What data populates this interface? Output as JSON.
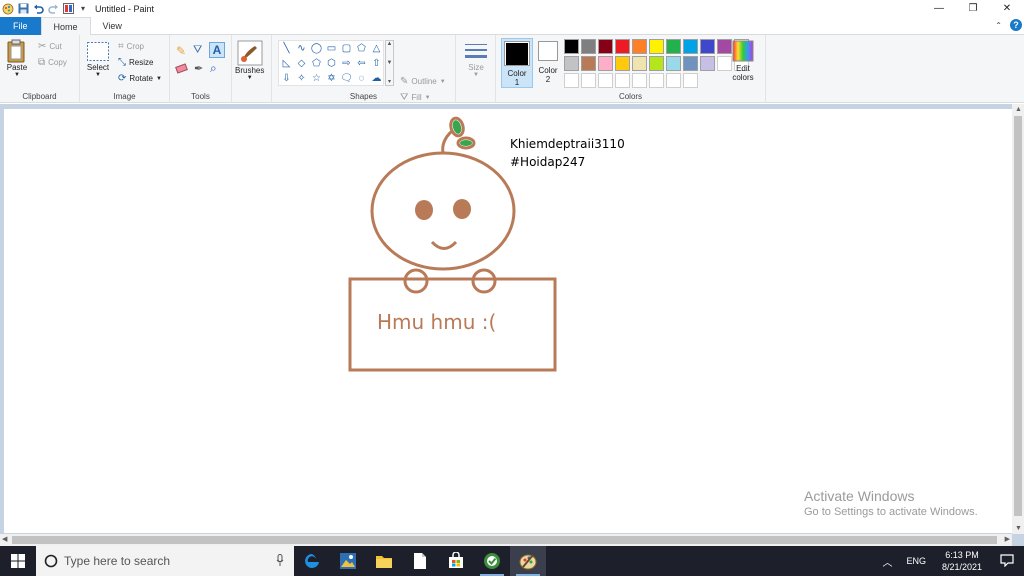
{
  "window": {
    "title": "Untitled - Paint",
    "controls": {
      "minimize": "—",
      "restore": "❐",
      "close": "✕"
    }
  },
  "tabs": {
    "file": "File",
    "home": "Home",
    "view": "View"
  },
  "ribbon": {
    "clipboard": {
      "label": "Clipboard",
      "paste": "Paste",
      "cut": "Cut",
      "copy": "Copy"
    },
    "image": {
      "label": "Image",
      "select": "Select",
      "crop": "Crop",
      "resize": "Resize",
      "rotate": "Rotate"
    },
    "tools": {
      "label": "Tools"
    },
    "brushes": {
      "label": "Brushes"
    },
    "shapes": {
      "label": "Shapes",
      "outline": "Outline",
      "fill": "Fill"
    },
    "size": {
      "label": "Size"
    },
    "color1": {
      "label": "Color",
      "num": "1",
      "value": "#000000"
    },
    "color2": {
      "label": "Color",
      "num": "2",
      "value": "#ffffff"
    },
    "colors": {
      "label": "Colors",
      "edit": "Edit",
      "edit2": "colors",
      "palette": [
        "#000000",
        "#7f7f7f",
        "#880015",
        "#ed1c24",
        "#ff7f27",
        "#fff200",
        "#22b14c",
        "#00a2e8",
        "#3f48cc",
        "#a349a4",
        "#ffffff",
        "#c3c3c3",
        "#b97a57",
        "#ffaec9",
        "#ffc90e",
        "#efe4b0",
        "#b5e61d",
        "#99d9ea",
        "#7092be",
        "#c8bfe7",
        "#ffffff",
        "#ffffff",
        "#ffffff",
        "#ffffff",
        "#ffffff",
        "#ffffff",
        "#ffffff",
        "#ffffff",
        "#ffffff",
        "#ffffff"
      ]
    }
  },
  "canvas": {
    "stroke_color": "#b97a57",
    "leaf_color": "#3aa54f",
    "note_line1": "Khiemdeptraii3110",
    "note_line2": "#Hoidap247",
    "sign_text": "Hmu hmu :("
  },
  "watermark": {
    "title": "Activate Windows",
    "subtitle": "Go to Settings to activate Windows."
  },
  "taskbar": {
    "search_placeholder": "Type here to search",
    "language": "ENG",
    "time": "6:13 PM",
    "date": "8/21/2021"
  }
}
